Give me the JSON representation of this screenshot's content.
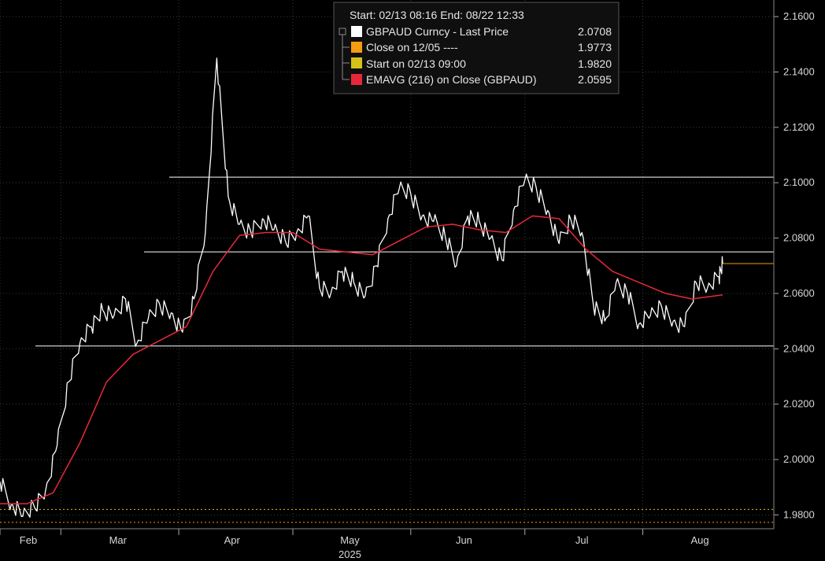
{
  "legend": {
    "header": "Start: 02/13 08:16 End: 08/22 12:33",
    "items": [
      {
        "label": "GBPAUD Curncy - Last Price",
        "value": "2.0708",
        "color": "#ffffff"
      },
      {
        "label": "Close on 12/05 ----",
        "value": "1.9773",
        "color": "#f39c12"
      },
      {
        "label": "Start on 02/13 09:00",
        "value": "1.9820",
        "color": "#d4c21a"
      },
      {
        "label": "EMAVG (216)  on Close (GBPAUD)",
        "value": "2.0595",
        "color": "#e8283a"
      }
    ]
  },
  "chart_data": {
    "type": "line",
    "x_labels": [
      "Feb",
      "Mar",
      "Apr",
      "May",
      "Jun",
      "Jul",
      "Aug"
    ],
    "x_year": "2025",
    "y_ticks": [
      "1.9800",
      "2.0000",
      "2.0200",
      "2.0400",
      "2.0600",
      "2.0800",
      "2.1000",
      "2.1200",
      "2.1400",
      "2.1600"
    ],
    "ylim": [
      1.975,
      2.166
    ],
    "grid": true,
    "x_range": [
      "2025-02-13",
      "2025-08-22"
    ],
    "series": [
      {
        "name": "GBPAUD Curncy - Last Price",
        "color": "#ffffff",
        "x": [
          "2025-02-13",
          "2025-02-16",
          "2025-02-19",
          "2025-02-22",
          "2025-02-25",
          "2025-02-28",
          "2025-03-03",
          "2025-03-06",
          "2025-03-09",
          "2025-03-12",
          "2025-03-15",
          "2025-03-18",
          "2025-03-21",
          "2025-03-24",
          "2025-03-27",
          "2025-03-30",
          "2025-04-02",
          "2025-04-05",
          "2025-04-08",
          "2025-04-11",
          "2025-04-14",
          "2025-04-17",
          "2025-04-20",
          "2025-04-23",
          "2025-04-26",
          "2025-04-29",
          "2025-05-02",
          "2025-05-05",
          "2025-05-08",
          "2025-05-11",
          "2025-05-14",
          "2025-05-17",
          "2025-05-20",
          "2025-05-23",
          "2025-05-26",
          "2025-05-29",
          "2025-06-01",
          "2025-06-04",
          "2025-06-07",
          "2025-06-10",
          "2025-06-13",
          "2025-06-16",
          "2025-06-19",
          "2025-06-22",
          "2025-06-25",
          "2025-06-28",
          "2025-07-01",
          "2025-07-04",
          "2025-07-07",
          "2025-07-10",
          "2025-07-13",
          "2025-07-16",
          "2025-07-19",
          "2025-07-22",
          "2025-07-25",
          "2025-07-28",
          "2025-07-31",
          "2025-08-03",
          "2025-08-06",
          "2025-08-09",
          "2025-08-12",
          "2025-08-15",
          "2025-08-18",
          "2025-08-21",
          "2025-08-22"
        ],
        "y": [
          1.992,
          1.984,
          1.9795,
          1.983,
          1.989,
          2.005,
          2.028,
          2.042,
          2.048,
          2.054,
          2.052,
          2.058,
          2.042,
          2.051,
          2.056,
          2.053,
          2.046,
          2.058,
          2.082,
          2.145,
          2.095,
          2.085,
          2.082,
          2.087,
          2.083,
          2.079,
          2.082,
          2.088,
          2.062,
          2.06,
          2.068,
          2.064,
          2.059,
          2.07,
          2.087,
          2.098,
          2.096,
          2.088,
          2.086,
          2.081,
          2.07,
          2.088,
          2.086,
          2.08,
          2.072,
          2.09,
          2.101,
          2.098,
          2.09,
          2.078,
          2.087,
          2.082,
          2.056,
          2.05,
          2.064,
          2.06,
          2.049,
          2.052,
          2.055,
          2.05,
          2.048,
          2.064,
          2.062,
          2.066,
          2.0708
        ]
      },
      {
        "name": "EMAVG (216)  on Close (GBPAUD)",
        "color": "#e8283a",
        "x": [
          "2025-02-13",
          "2025-02-20",
          "2025-02-27",
          "2025-03-06",
          "2025-03-13",
          "2025-03-20",
          "2025-03-27",
          "2025-04-03",
          "2025-04-10",
          "2025-04-17",
          "2025-04-24",
          "2025-05-01",
          "2025-05-08",
          "2025-05-15",
          "2025-05-22",
          "2025-05-29",
          "2025-06-05",
          "2025-06-12",
          "2025-06-19",
          "2025-06-26",
          "2025-07-03",
          "2025-07-10",
          "2025-07-17",
          "2025-07-24",
          "2025-07-31",
          "2025-08-07",
          "2025-08-14",
          "2025-08-22"
        ],
        "y": [
          1.984,
          1.984,
          1.988,
          2.006,
          2.028,
          2.038,
          2.043,
          2.048,
          2.068,
          2.081,
          2.082,
          2.082,
          2.076,
          2.075,
          2.074,
          2.079,
          2.084,
          2.085,
          2.083,
          2.082,
          2.088,
          2.087,
          2.076,
          2.068,
          2.064,
          2.06,
          2.058,
          2.0595
        ]
      }
    ],
    "reference_lines": [
      {
        "y": 2.102,
        "color": "#ffffff"
      },
      {
        "y": 2.075,
        "color": "#ffffff"
      },
      {
        "y": 2.041,
        "color": "#ffffff"
      },
      {
        "y": 2.0708,
        "color": "#f39c12"
      },
      {
        "y": 1.982,
        "color": "#d4c21a"
      },
      {
        "y": 1.9773,
        "color": "#f39c12"
      }
    ]
  }
}
